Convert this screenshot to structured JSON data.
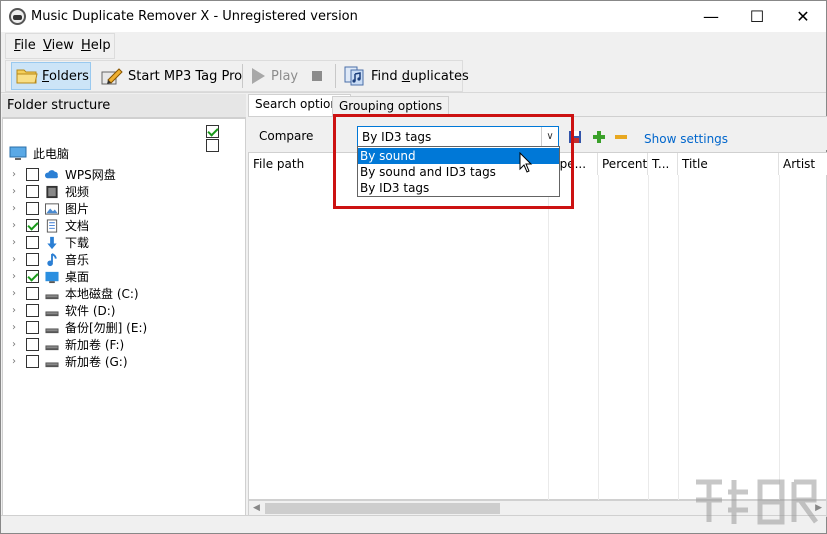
{
  "window": {
    "title": "Music Duplicate Remover X - Unregistered version",
    "controls": {
      "minimize": "—",
      "maximize": "☐",
      "close": "✕"
    }
  },
  "menu": {
    "file": {
      "accel": "F",
      "rest": "ile"
    },
    "view": {
      "accel": "V",
      "rest": "iew"
    },
    "help": {
      "accel": "H",
      "rest": "elp"
    }
  },
  "toolbar": {
    "folders": {
      "accel": "F",
      "rest": "olders",
      "icon": "folder-icon"
    },
    "mp3tag": {
      "label": "Start MP3 Tag Pro",
      "icon": "tag-edit-icon"
    },
    "play": {
      "label": "Play",
      "icon": "play-icon"
    },
    "stop": {
      "icon": "stop-icon"
    },
    "find": {
      "pre": "Find ",
      "accel": "d",
      "rest": "uplicates",
      "icon": "find-duplicates-icon"
    }
  },
  "folder_panel": {
    "header": "Folder structure",
    "root": {
      "label": "此电脑",
      "icon": "computer-icon"
    },
    "items": [
      {
        "label": "WPS网盘",
        "icon": "cloud-icon",
        "checked": false
      },
      {
        "label": "视频",
        "icon": "video-icon",
        "checked": false
      },
      {
        "label": "图片",
        "icon": "picture-icon",
        "checked": false
      },
      {
        "label": "文档",
        "icon": "document-icon",
        "checked": true
      },
      {
        "label": "下载",
        "icon": "download-icon",
        "checked": false
      },
      {
        "label": "音乐",
        "icon": "music-icon",
        "checked": false
      },
      {
        "label": "桌面",
        "icon": "desktop-icon",
        "checked": true
      },
      {
        "label": "本地磁盘 (C:)",
        "icon": "drive-icon",
        "checked": false
      },
      {
        "label": "软件 (D:)",
        "icon": "drive-icon",
        "checked": false
      },
      {
        "label": "备份[勿删] (E:)",
        "icon": "drive-icon",
        "checked": false
      },
      {
        "label": "新加卷 (F:)",
        "icon": "drive-icon",
        "checked": false
      },
      {
        "label": "新加卷 (G:)",
        "icon": "drive-icon",
        "checked": false
      }
    ]
  },
  "tabs": [
    {
      "label": "Search options",
      "active": true
    },
    {
      "label": "Grouping options",
      "active": false
    }
  ],
  "options": {
    "compare_label": "Compare",
    "compare_value": "By ID3 tags",
    "show_settings": "Show settings",
    "dropdown_options": [
      "By sound",
      "By sound and ID3 tags",
      "By ID3 tags"
    ],
    "dropdown_selected_index": 0
  },
  "grid": {
    "columns": [
      "File path",
      "",
      "Spe...",
      "Percent",
      "T...",
      "Title",
      "Artist"
    ]
  }
}
